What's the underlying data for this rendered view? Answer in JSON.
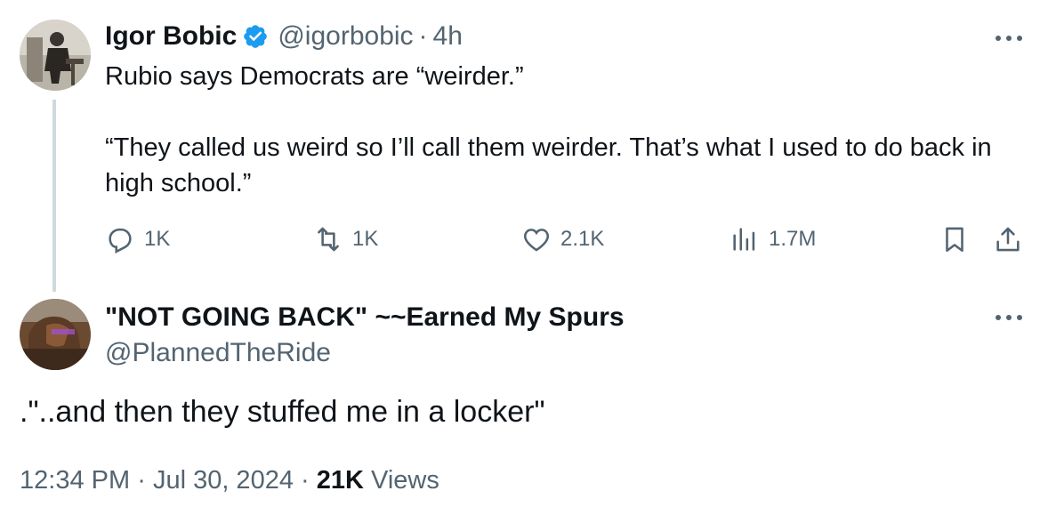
{
  "original_tweet": {
    "author_name": "Igor Bobic",
    "handle": "@igorbobic",
    "separator": "·",
    "time_ago": "4h",
    "verified_icon": "verified-badge-icon",
    "text": "Rubio says Democrats are “weirder.”\n\n“They called us weird so I’ll call them weirder. That’s what I used to do back in high school.”",
    "actions": {
      "replies": "1K",
      "reposts": "1K",
      "likes": "2.1K",
      "views": "1.7M"
    }
  },
  "reply_tweet": {
    "author_name": "\"NOT GOING BACK\" ~~Earned My Spurs",
    "handle": "@PlannedTheRide",
    "text": ".\"..and then they stuffed me in a locker\"",
    "time": "12:34 PM",
    "date": "Jul 30, 2024",
    "separator": "·",
    "views_count": "21K",
    "views_label": "Views"
  },
  "colors": {
    "text": "#0f1419",
    "secondary": "#536471",
    "verified": "#1d9bf0",
    "thread_line": "#cfd9de"
  }
}
